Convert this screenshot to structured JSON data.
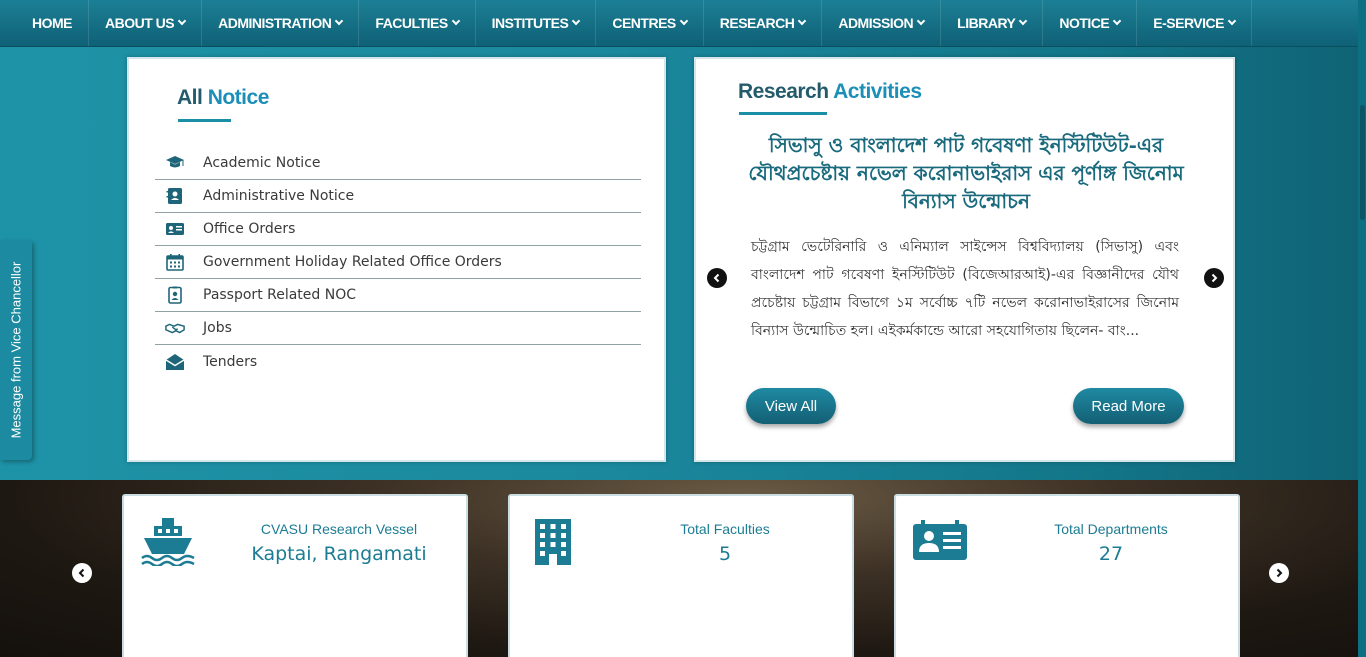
{
  "nav": {
    "items": [
      {
        "label": "HOME",
        "dropdown": false
      },
      {
        "label": "ABOUT US",
        "dropdown": true
      },
      {
        "label": "ADMINISTRATION",
        "dropdown": true
      },
      {
        "label": "FACULTIES",
        "dropdown": true
      },
      {
        "label": "INSTITUTES",
        "dropdown": true
      },
      {
        "label": "CENTRES",
        "dropdown": true
      },
      {
        "label": "RESEARCH",
        "dropdown": true
      },
      {
        "label": "ADMISSION",
        "dropdown": true
      },
      {
        "label": "LIBRARY",
        "dropdown": true
      },
      {
        "label": "NOTICE",
        "dropdown": true
      },
      {
        "label": "E-SERVICE",
        "dropdown": true
      }
    ]
  },
  "vc_tab": {
    "label": "Message from Vice Chancellor"
  },
  "notice": {
    "title_a": "All",
    "title_b": "Notice",
    "items": [
      {
        "label": "Academic Notice",
        "icon": "graduation-cap-icon"
      },
      {
        "label": "Administrative Notice",
        "icon": "address-book-icon"
      },
      {
        "label": "Office Orders",
        "icon": "id-card-icon"
      },
      {
        "label": "Government Holiday Related Office Orders",
        "icon": "calendar-icon"
      },
      {
        "label": "Passport Related NOC",
        "icon": "id-badge-icon"
      },
      {
        "label": "Jobs",
        "icon": "handshake-icon"
      },
      {
        "label": "Tenders",
        "icon": "envelope-open-icon"
      }
    ]
  },
  "research": {
    "title_a": "Research",
    "title_b": "Activities",
    "headline": "সিভাসু ও বাংলাদেশ পাট গবেষণা ইনস্টিটিউট-এর যৌথপ্রচেষ্টায় নভেল করোনাভাইরাস এর পূর্ণাঙ্গ জিনোম বিন্যাস উন্মোচন",
    "body": "চট্টগ্রাম ভেটেরিনারি ও এনিম্যাল সাইন্সেস বিশ্ববিদ্যালয় (সিভাসু) এবং বাংলাদেশ পাট গবেষণা ইনস্টিটিউট (বিজেআরআই)-এর বিজ্ঞানীদের যৌথ প্রচেষ্টায় চট্টগ্রাম বিভাগে ১ম সর্বোচ্চ ৭টি নভেল করোনাভাইরাসের জিনোম বিন্যাস উন্মোচিত হল। এইকর্মকান্ডে আরো সহযোগিতায় ছিলেন- বাং...",
    "view_all": "View All",
    "read_more": "Read More"
  },
  "stats": [
    {
      "label": "CVASU Research Vessel",
      "value": "Kaptai, Rangamati",
      "icon": "ship-icon"
    },
    {
      "label": "Total Faculties",
      "value": "5",
      "icon": "building-icon"
    },
    {
      "label": "Total Departments",
      "value": "27",
      "icon": "department-card-icon"
    }
  ],
  "colors": {
    "accent": "#1b8fa6",
    "nav_bg": "#0f6176",
    "title_dark": "#235b6b",
    "title_light": "#1b8fb8"
  }
}
